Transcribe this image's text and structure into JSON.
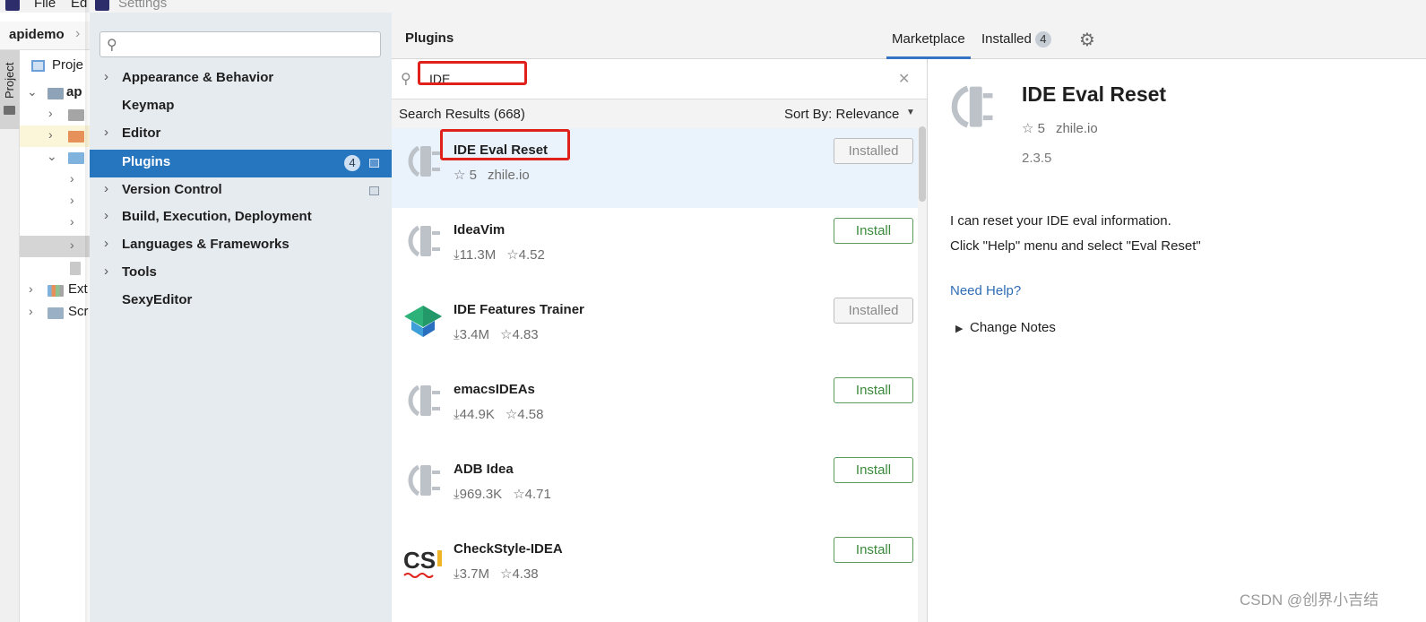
{
  "ide": {
    "menu": [
      "File",
      "Ed"
    ],
    "project_name": "apidemo",
    "strip_label": "Project",
    "tree_header": "Proje",
    "tree_root": "ap",
    "tree_ext": "Ext",
    "tree_scr": "Scr"
  },
  "dialog": {
    "title": "Settings"
  },
  "sidebar": {
    "search_placeholder": "",
    "items": [
      {
        "label": "Appearance & Behavior",
        "expandable": true
      },
      {
        "label": "Keymap",
        "expandable": false
      },
      {
        "label": "Editor",
        "expandable": true
      },
      {
        "label": "Plugins",
        "expandable": false,
        "badge": "4",
        "selected": true
      },
      {
        "label": "Version Control",
        "expandable": true
      },
      {
        "label": "Build, Execution, Deployment",
        "expandable": true
      },
      {
        "label": "Languages & Frameworks",
        "expandable": true
      },
      {
        "label": "Tools",
        "expandable": true
      },
      {
        "label": "SexyEditor",
        "expandable": false
      }
    ]
  },
  "plugins": {
    "title": "Plugins",
    "tabs": {
      "marketplace": "Marketplace",
      "installed": "Installed",
      "installed_count": "4"
    },
    "search_query": "IDE",
    "results_label": "Search Results (668)",
    "sort_label": "Sort By: Relevance",
    "list": [
      {
        "name": "IDE Eval Reset",
        "downloads": "",
        "rating": "5",
        "vendor": "zhile.io",
        "button": "Installed",
        "state": "installed",
        "logo": "plug-icon"
      },
      {
        "name": "IdeaVim",
        "downloads": "11.3M",
        "rating": "4.52",
        "vendor": "",
        "button": "Install",
        "state": "install",
        "logo": "plug-icon"
      },
      {
        "name": "IDE Features Trainer",
        "downloads": "3.4M",
        "rating": "4.83",
        "vendor": "",
        "button": "Installed",
        "state": "installed",
        "logo": "graduation-cap-icon"
      },
      {
        "name": "emacsIDEAs",
        "downloads": "44.9K",
        "rating": "4.58",
        "vendor": "",
        "button": "Install",
        "state": "install",
        "logo": "plug-icon"
      },
      {
        "name": "ADB Idea",
        "downloads": "969.3K",
        "rating": "4.71",
        "vendor": "",
        "button": "Install",
        "state": "install",
        "logo": "plug-icon"
      },
      {
        "name": "CheckStyle-IDEA",
        "downloads": "3.7M",
        "rating": "4.38",
        "vendor": "",
        "button": "Install",
        "state": "install",
        "logo": "checkstyle-icon"
      }
    ]
  },
  "detail": {
    "name": "IDE Eval Reset",
    "rating": "5",
    "vendor": "zhile.io",
    "version": "2.3.5",
    "description_line1": "I can reset your IDE eval information.",
    "description_line2": "Click \"Help\" menu and select \"Eval Reset\"",
    "need_help": "Need Help?",
    "change_notes": "Change Notes"
  },
  "watermark": "CSDN @创界小吉结",
  "colors": {
    "accent": "#2675bf",
    "install_green": "#3b8a3b",
    "link": "#2f6db5",
    "annotation_red": "#e0201b"
  }
}
